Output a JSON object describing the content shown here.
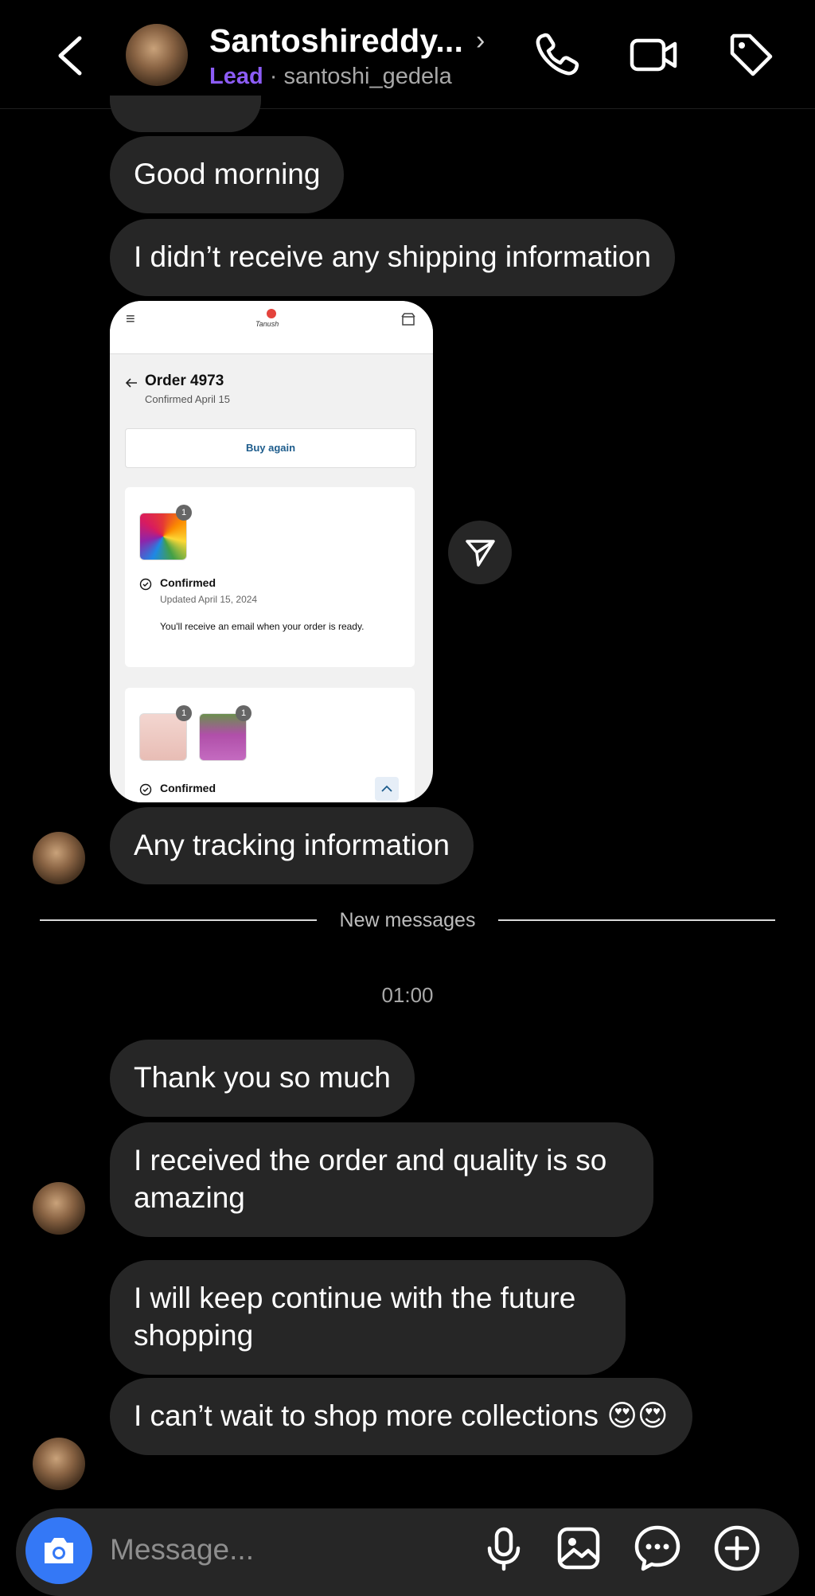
{
  "header": {
    "name": "Santoshireddy...",
    "chevron": "›",
    "lead_label": "Lead",
    "separator": " · ",
    "username": "santoshi_gedela",
    "icons": [
      "back-icon",
      "phone-icon",
      "video-camera-icon",
      "tag-icon"
    ]
  },
  "messages": [
    "Good morning",
    "I didn’t receive any shipping information",
    "Any tracking information",
    "Thank you so much",
    "I received the order and quality is so amazing",
    "I will keep continue with the future shopping",
    "I can’t wait to shop more collections 😍😍"
  ],
  "screenshot": {
    "menu_glyph": "≡",
    "brand": "Tanush",
    "order_title": "Order 4973",
    "order_date": "Confirmed April 15",
    "buy_again": "Buy again",
    "badge_count": "1",
    "status1": "Confirmed",
    "status1_updated": "Updated April 15, 2024",
    "status1_note": "You'll receive an email when your order is ready.",
    "status2": "Confirmed"
  },
  "divider_label": "New messages",
  "timestamp": "01:00",
  "composer": {
    "placeholder": "Message...",
    "icons": [
      "camera-icon",
      "microphone-icon",
      "gallery-icon",
      "sticker-chat-icon",
      "plus-circle-icon"
    ]
  },
  "colors": {
    "background": "#000000",
    "bubble": "#262626",
    "lead": "#8c5cf6",
    "camera_button": "#3478f6"
  }
}
